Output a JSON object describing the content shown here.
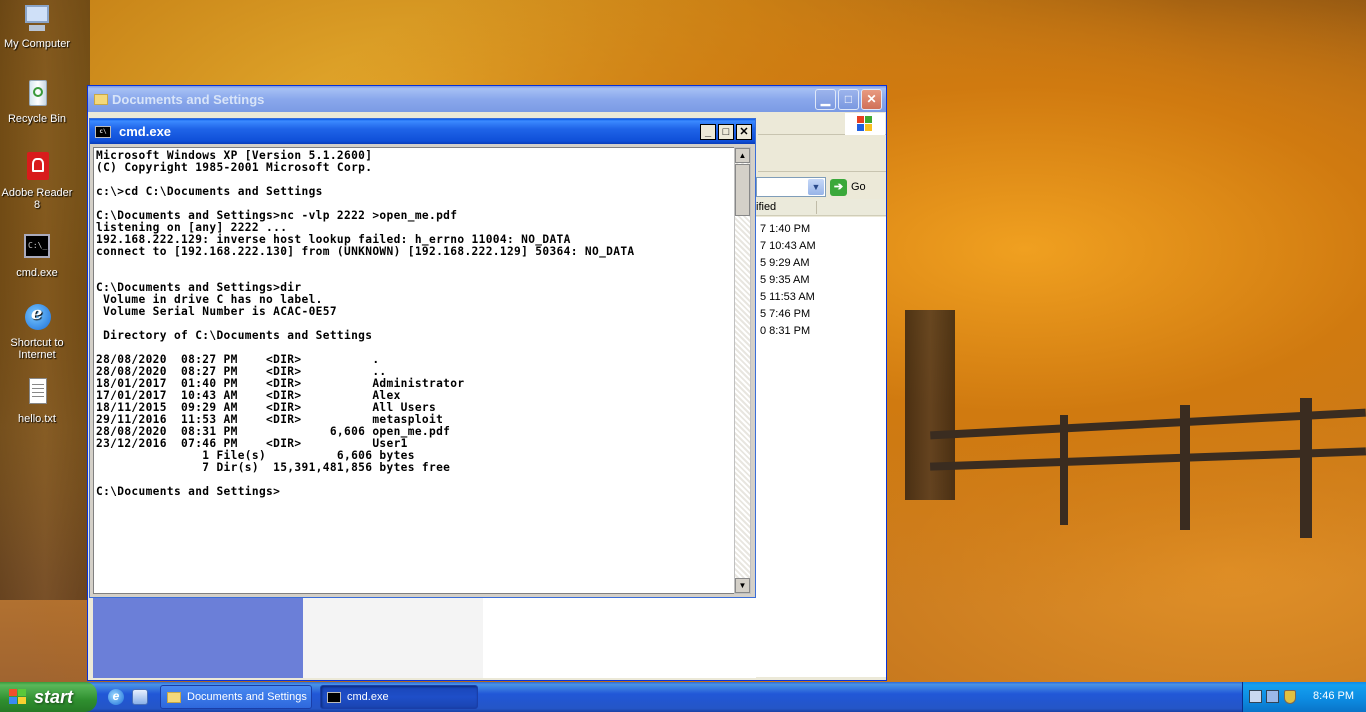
{
  "desktop": {
    "icons": [
      {
        "label": "My Computer"
      },
      {
        "label": "Recycle Bin"
      },
      {
        "label": "Adobe Reader 8"
      },
      {
        "label": "cmd.exe"
      },
      {
        "label": "Shortcut to Internet"
      },
      {
        "label": "hello.txt"
      }
    ]
  },
  "explorer": {
    "title": "Documents and Settings",
    "go_label": "Go",
    "column_partial": "ified",
    "modified_partial": [
      "7 1:40 PM",
      "7 10:43 AM",
      "5 9:29 AM",
      "5 9:35 AM",
      "5 11:53 AM",
      "5 7:46 PM",
      "0 8:31 PM"
    ]
  },
  "cmd": {
    "title": "cmd.exe",
    "lines": [
      "Microsoft Windows XP [Version 5.1.2600]",
      "(C) Copyright 1985-2001 Microsoft Corp.",
      "",
      "c:\\>cd C:\\Documents and Settings",
      "",
      "C:\\Documents and Settings>nc -vlp 2222 >open_me.pdf",
      "listening on [any] 2222 ...",
      "192.168.222.129: inverse host lookup failed: h_errno 11004: NO_DATA",
      "connect to [192.168.222.130] from (UNKNOWN) [192.168.222.129] 50364: NO_DATA",
      "",
      "",
      "C:\\Documents and Settings>dir",
      " Volume in drive C has no label.",
      " Volume Serial Number is ACAC-0E57",
      "",
      " Directory of C:\\Documents and Settings",
      "",
      "28/08/2020  08:27 PM    <DIR>          .",
      "28/08/2020  08:27 PM    <DIR>          ..",
      "18/01/2017  01:40 PM    <DIR>          Administrator",
      "17/01/2017  10:43 AM    <DIR>          Alex",
      "18/11/2015  09:29 AM    <DIR>          All Users",
      "29/11/2016  11:53 AM    <DIR>          metasploit",
      "28/08/2020  08:31 PM             6,606 open_me.pdf",
      "23/12/2016  07:46 PM    <DIR>          User1",
      "               1 File(s)          6,606 bytes",
      "               7 Dir(s)  15,391,481,856 bytes free",
      "",
      "C:\\Documents and Settings>"
    ]
  },
  "taskbar": {
    "start_label": "start",
    "tasks": [
      {
        "label": "Documents and Settings"
      },
      {
        "label": "cmd.exe"
      }
    ],
    "clock": "8:46 PM"
  },
  "colors": {
    "xp_blue": "#0f4fd8",
    "start_green": "#2f8f2f",
    "selection_blue": "#6b7fd8"
  }
}
